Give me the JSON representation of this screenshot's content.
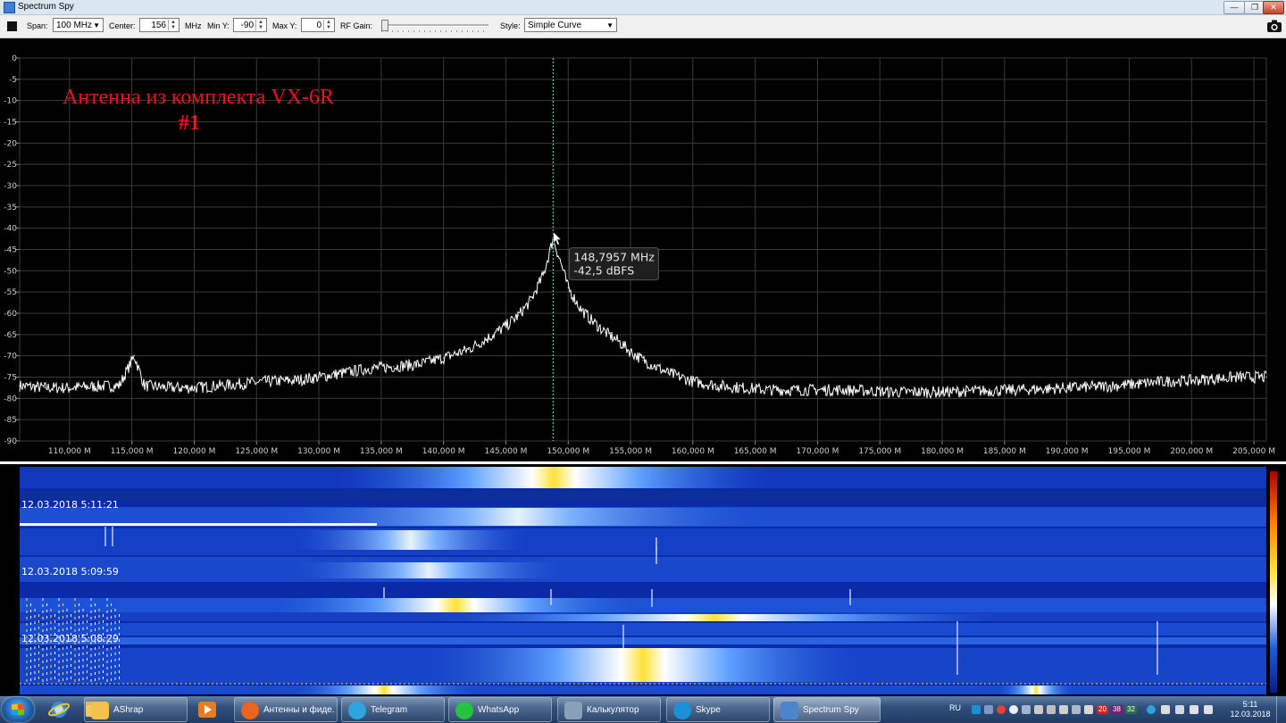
{
  "window": {
    "title": "Spectrum Spy",
    "controls": [
      "minimize",
      "maximize",
      "close"
    ]
  },
  "toolbar": {
    "span_label": "Span:",
    "span_value": "100 MHz",
    "center_label": "Center:",
    "center_value": "156",
    "center_unit": "MHz",
    "miny_label": "Min Y:",
    "miny_value": "-90",
    "maxy_label": "Max Y:",
    "maxy_value": "0",
    "rfgain_label": "RF Gain:",
    "rfgain_level": 0,
    "style_label": "Style:",
    "style_value": "Simple Curve",
    "icons": [
      "color-swatch-icon",
      "camera-icon"
    ]
  },
  "spectrum": {
    "overlay_title_line1": "Антенна из комплекта VX-6R",
    "overlay_title_line2": "#1",
    "overlay_color": "#e8141e",
    "cursor_freq": "148,7957 MHz",
    "cursor_level": "-42,5 dBFS",
    "cursor_color": "#1fd39a"
  },
  "chart_data": {
    "type": "line",
    "title": "",
    "xlabel": "",
    "ylabel": "",
    "x_unit": "MHz",
    "y_unit": "dBFS",
    "xlim": [
      106,
      206
    ],
    "ylim": [
      -90,
      0
    ],
    "grid": true,
    "x_ticks": [
      110,
      115,
      120,
      125,
      130,
      135,
      140,
      145,
      150,
      155,
      160,
      165,
      170,
      175,
      180,
      185,
      190,
      195,
      200,
      205
    ],
    "x_tick_labels": [
      "110,000 M",
      "115,000 M",
      "120,000 M",
      "125,000 M",
      "130,000 M",
      "135,000 M",
      "140,000 M",
      "145,000 M",
      "150,000 M",
      "155,000 M",
      "160,000 M",
      "165,000 M",
      "170,000 M",
      "175,000 M",
      "180,000 M",
      "185,000 M",
      "190,000 M",
      "195,000 M",
      "200,000 M",
      "205,000 M"
    ],
    "y_ticks": [
      0,
      -5,
      -10,
      -15,
      -20,
      -25,
      -30,
      -35,
      -40,
      -45,
      -50,
      -55,
      -60,
      -65,
      -70,
      -75,
      -80,
      -85,
      -90
    ],
    "y_tick_labels": [
      "0",
      "-5",
      "-10",
      "-15",
      "-20",
      "-25",
      "-30",
      "-35",
      "-40",
      "-45",
      "-50",
      "-55",
      "-60",
      "-65",
      "-70",
      "-75",
      "-80",
      "-85",
      "-90"
    ],
    "cursor": {
      "x": 148.7957,
      "y": -42.5
    },
    "series": [
      {
        "color": "#ffffff",
        "x": [
          106,
          108,
          110,
          112,
          114,
          115.2,
          116,
          118,
          120,
          122,
          124,
          126,
          128,
          130,
          132,
          134,
          136,
          138,
          140,
          142,
          144,
          145,
          146,
          147,
          148,
          148.8,
          149.5,
          150,
          151,
          152,
          153,
          154,
          155,
          156,
          157,
          158,
          160,
          162,
          164,
          166,
          168,
          170,
          172,
          174,
          176,
          178,
          180,
          182,
          184,
          186,
          188,
          190,
          192,
          194,
          196,
          198,
          200,
          202,
          204,
          206
        ],
        "y": [
          -77,
          -77.5,
          -77.5,
          -77.2,
          -77,
          -70,
          -77,
          -77.5,
          -77.5,
          -77,
          -76.5,
          -76,
          -75.8,
          -75,
          -74,
          -73,
          -72.5,
          -72,
          -70.5,
          -68.5,
          -65,
          -63,
          -60.5,
          -57,
          -51,
          -42.5,
          -49,
          -54,
          -59,
          -62,
          -64.5,
          -66.5,
          -69,
          -71,
          -72.5,
          -74,
          -76,
          -77,
          -77.5,
          -78,
          -78,
          -78,
          -78,
          -78.2,
          -78.5,
          -78.5,
          -78.5,
          -78.3,
          -78.2,
          -78,
          -77.8,
          -77.5,
          -77.3,
          -77,
          -76.5,
          -76,
          -75.8,
          -75.3,
          -75,
          -75
        ]
      }
    ]
  },
  "waterfall": {
    "timestamps": [
      "12.03.2018 5:11:21",
      "12.03.2018 5:09:59",
      "12.03.2018 5:08:29"
    ],
    "palette": [
      "#0a1d8c",
      "#1f5bd4",
      "#ffffff",
      "#ffe135",
      "#ff8c00"
    ]
  },
  "taskbar": {
    "start": "Start",
    "pinned": [
      "internet-explorer-icon",
      "file-explorer-icon",
      "media-player-icon"
    ],
    "tasks": [
      {
        "label": "AShrap",
        "active": false,
        "icon": "folder-icon"
      },
      {
        "label": "Антенны и фиде...",
        "active": false,
        "icon": "firefox-icon"
      },
      {
        "label": "Telegram",
        "active": false,
        "icon": "telegram-icon"
      },
      {
        "label": "WhatsApp",
        "active": false,
        "icon": "whatsapp-icon"
      },
      {
        "label": "Калькулятор",
        "active": false,
        "icon": "calculator-icon"
      },
      {
        "label": "Skype",
        "active": false,
        "icon": "skype-icon"
      },
      {
        "label": "Spectrum Spy",
        "active": true,
        "icon": "spectrum-spy-icon"
      }
    ],
    "tray": {
      "language": "RU",
      "badges": [
        "20",
        "38",
        "32"
      ],
      "time": "5:11",
      "date": "12.03.2018"
    }
  }
}
